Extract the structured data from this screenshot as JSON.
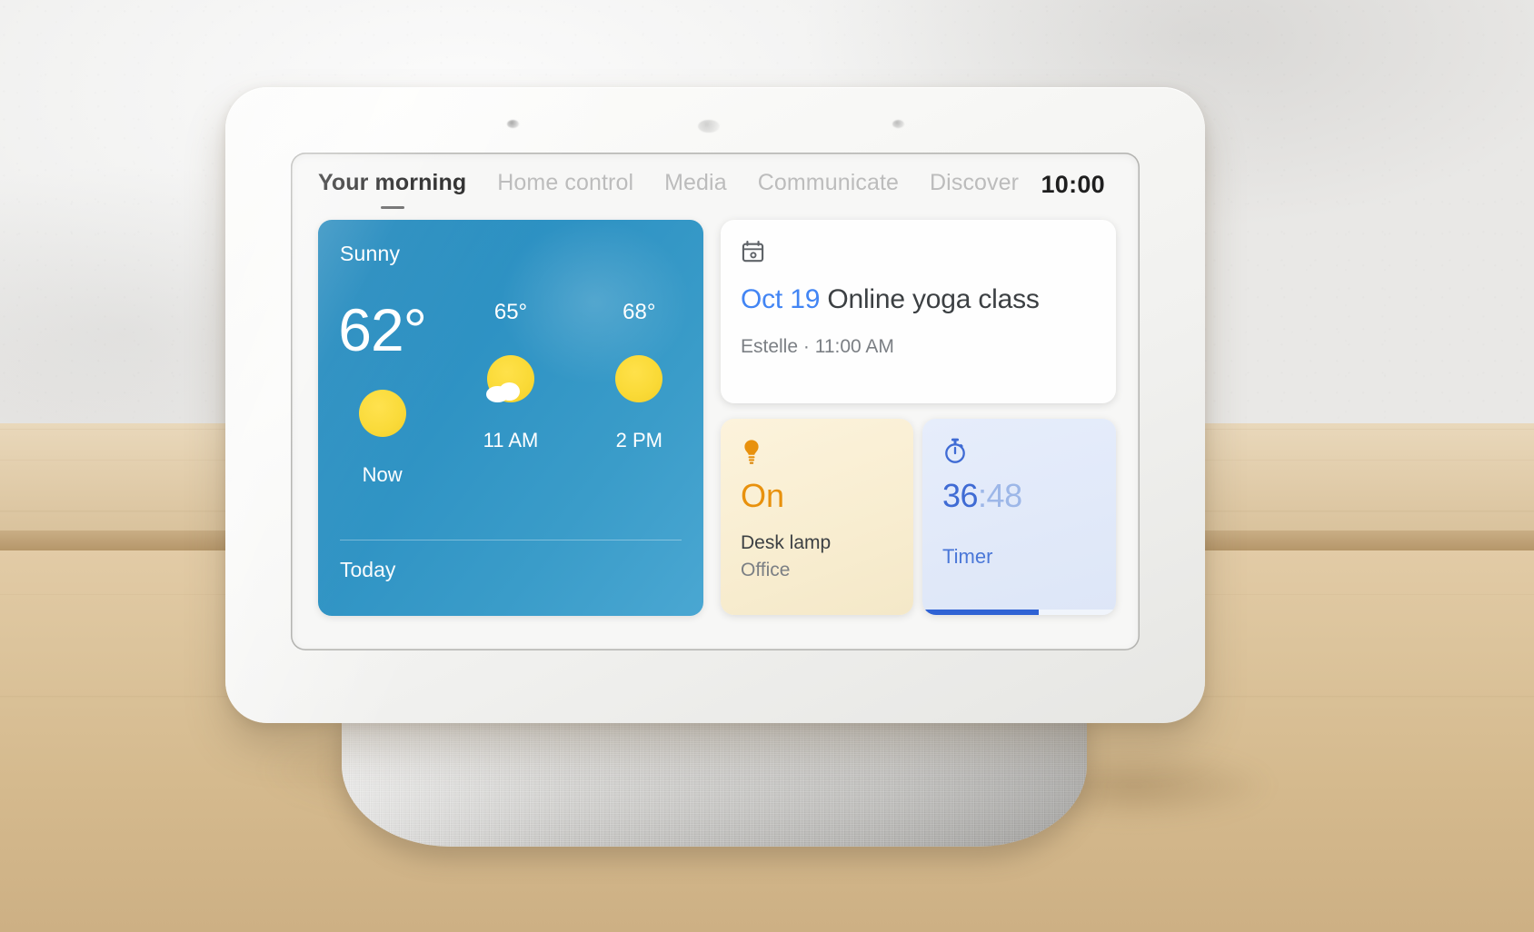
{
  "device": {
    "name": "Smart display",
    "status_clock": "10:00"
  },
  "nav": {
    "tabs": [
      {
        "label": "Your morning",
        "active": true
      },
      {
        "label": "Home control",
        "active": false
      },
      {
        "label": "Media",
        "active": false
      },
      {
        "label": "Communicate",
        "active": false
      },
      {
        "label": "Discover",
        "active": false
      }
    ]
  },
  "weather": {
    "condition": "Sunny",
    "accent_color": "#2f93c4",
    "forecast": [
      {
        "temp": "62°",
        "time": "Now",
        "icon": "sun-icon"
      },
      {
        "temp": "65°",
        "time": "11 AM",
        "icon": "sun-cloud-icon"
      },
      {
        "temp": "68°",
        "time": "2 PM",
        "icon": "sun-icon"
      }
    ],
    "footer": "Today"
  },
  "calendar": {
    "icon": "calendar-icon",
    "date": "Oct 19",
    "event": " Online yoga class",
    "details": "Estelle · 11:00 AM",
    "date_color": "#4285f4"
  },
  "lamp": {
    "icon": "lightbulb-icon",
    "state": "On",
    "name": "Desk lamp",
    "room": "Office",
    "accent_color": "#e8910d"
  },
  "timer": {
    "icon": "stopwatch-icon",
    "minutes": "36",
    "separator_seconds": ":48",
    "label": "Timer",
    "progress_percent": 60,
    "accent_color": "#2f62d4"
  }
}
